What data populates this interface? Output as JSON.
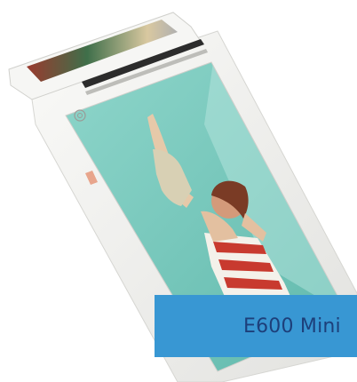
{
  "caption": {
    "text": "E600 Mini",
    "background": "#3897d3",
    "text_color": "#1d3f7a"
  },
  "device": {
    "body_color": "#f3f3f1",
    "screen_background": "#7ccdc0",
    "logo_icon": "pax-logo-icon"
  }
}
